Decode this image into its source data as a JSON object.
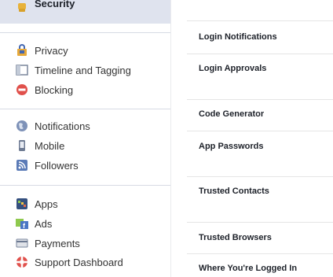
{
  "sidebar": {
    "selected": {
      "label": "Security",
      "icon": "badge-icon"
    },
    "groups": [
      {
        "items": [
          {
            "label": "Privacy",
            "icon": "privacy-lock-icon"
          },
          {
            "label": "Timeline and Tagging",
            "icon": "timeline-icon"
          },
          {
            "label": "Blocking",
            "icon": "block-icon"
          }
        ]
      },
      {
        "items": [
          {
            "label": "Notifications",
            "icon": "globe-icon"
          },
          {
            "label": "Mobile",
            "icon": "mobile-icon"
          },
          {
            "label": "Followers",
            "icon": "rss-icon"
          }
        ]
      },
      {
        "items": [
          {
            "label": "Apps",
            "icon": "apps-icon"
          },
          {
            "label": "Ads",
            "icon": "ads-icon"
          },
          {
            "label": "Payments",
            "icon": "card-icon"
          },
          {
            "label": "Support Dashboard",
            "icon": "lifebuoy-icon"
          }
        ]
      }
    ]
  },
  "security_settings": {
    "rows": [
      {
        "label": "Login Notifications"
      },
      {
        "label": "Login Approvals"
      },
      {
        "label": "Code Generator"
      },
      {
        "label": "App Passwords"
      },
      {
        "label": "Trusted Contacts"
      },
      {
        "label": "Trusted Browsers"
      },
      {
        "label": "Where You're Logged In"
      }
    ]
  },
  "colors": {
    "selected_bg": "#dfe3ee",
    "text": "#333333",
    "heading_text": "#1d2129",
    "separator": "#e5e5e5"
  }
}
